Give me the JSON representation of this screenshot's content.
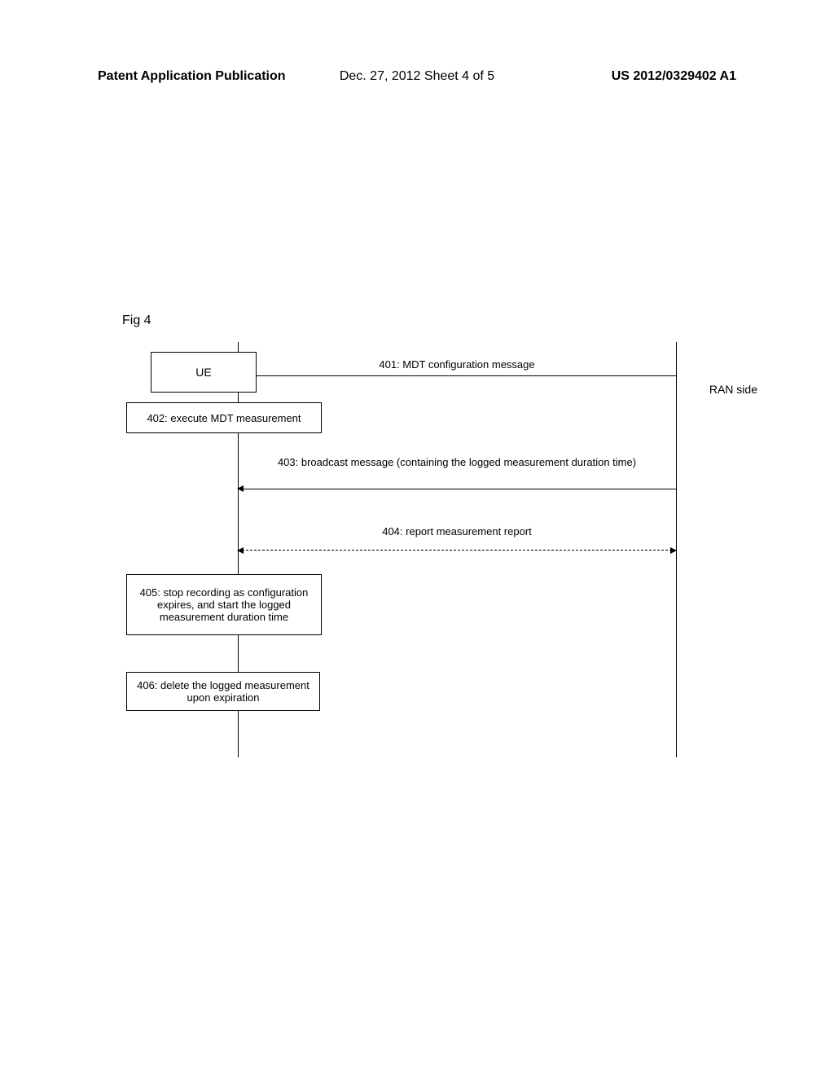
{
  "header": {
    "left": "Patent Application Publication",
    "center": "Dec. 27, 2012  Sheet 4 of 5",
    "right": "US 2012/0329402 A1"
  },
  "figure_label": "Fig 4",
  "diagram": {
    "ue_label": "UE",
    "ran_label": "RAN side",
    "msg_401": "401: MDT configuration message",
    "step_402": "402: execute MDT measurement",
    "msg_403": "403: broadcast message (containing the logged measurement duration time)",
    "msg_404": "404: report measurement report",
    "step_405": "405: stop recording as configuration expires, and start the logged measurement duration time",
    "step_406": "406: delete the  logged measurement upon expiration"
  }
}
